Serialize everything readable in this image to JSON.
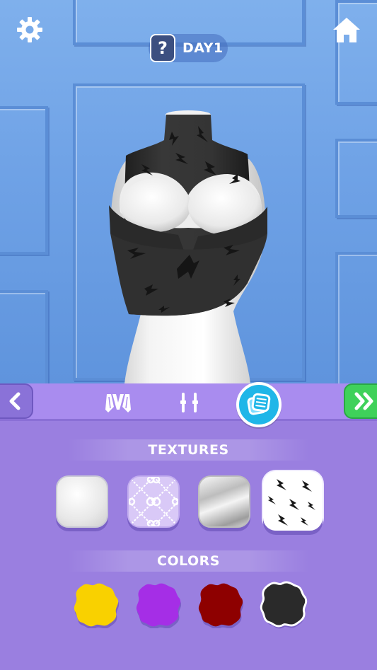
{
  "hud": {
    "settings_icon": "gear-icon",
    "home_icon": "home-icon",
    "help_label": "?",
    "day_label": "DAY1"
  },
  "toolbar": {
    "prev_icon": "chevron-left-icon",
    "next_icon": "double-chevron-right-icon",
    "tabs": [
      {
        "icon": "neckline-cut-icon",
        "selected": false
      },
      {
        "icon": "straps-icon",
        "selected": false
      },
      {
        "icon": "texture-icon",
        "selected": true
      }
    ],
    "accent_color": "#1fb6e8",
    "next_color": "#3fd15a"
  },
  "textures": {
    "title": "TEXTURES",
    "items": [
      {
        "name": "matte-white",
        "selected": false
      },
      {
        "name": "interlocking-pattern",
        "selected": false
      },
      {
        "name": "metallic",
        "selected": false
      },
      {
        "name": "lightning-bolt-print",
        "selected": true
      }
    ]
  },
  "colors": {
    "title": "COLORS",
    "items": [
      {
        "name": "yellow",
        "hex": "#f9d100",
        "selected": false
      },
      {
        "name": "purple",
        "hex": "#a52ee6",
        "selected": false
      },
      {
        "name": "dark-red",
        "hex": "#8e0000",
        "selected": false
      },
      {
        "name": "black",
        "hex": "#2a2a2a",
        "selected": true
      }
    ]
  },
  "scene": {
    "wall_color": "#6fa2e6",
    "garment_color": "#2e2e2e"
  }
}
